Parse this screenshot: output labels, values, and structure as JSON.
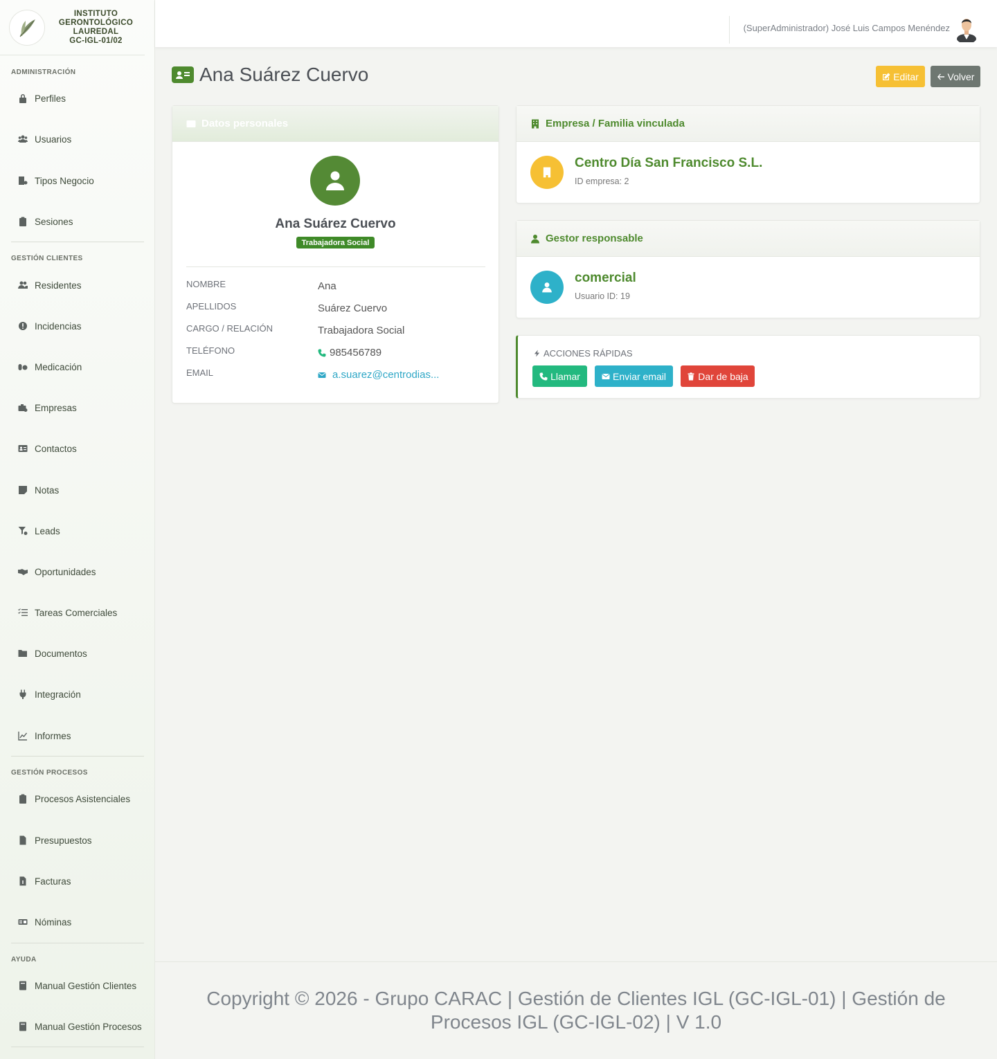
{
  "brand": {
    "lines": [
      "INSTITUTO",
      "GERONTOLÓGICO",
      "LAUREDAL",
      "GC-IGL-01/02"
    ]
  },
  "sidebar": {
    "sections": [
      {
        "label": "ADMINISTRACIÓN",
        "items": [
          {
            "label": "Perfiles",
            "icon": "lock-icon"
          },
          {
            "label": "Usuarios",
            "icon": "users-icon"
          },
          {
            "label": "Tipos Negocio",
            "icon": "building-icon"
          },
          {
            "label": "Sesiones",
            "icon": "clipboard-icon"
          }
        ]
      },
      {
        "label": "GESTIÓN CLIENTES",
        "items": [
          {
            "label": "Residentes",
            "icon": "users-icon"
          },
          {
            "label": "Incidencias",
            "icon": "alert-icon"
          },
          {
            "label": "Medicación",
            "icon": "pills-icon"
          },
          {
            "label": "Empresas",
            "icon": "briefcase-icon"
          },
          {
            "label": "Contactos",
            "icon": "id-card-icon"
          },
          {
            "label": "Notas",
            "icon": "note-icon"
          },
          {
            "label": "Leads",
            "icon": "funnel-icon"
          },
          {
            "label": "Oportunidades",
            "icon": "handshake-icon"
          },
          {
            "label": "Tareas Comerciales",
            "icon": "tasks-icon"
          },
          {
            "label": "Documentos",
            "icon": "folder-icon"
          },
          {
            "label": "Integración",
            "icon": "plug-icon"
          },
          {
            "label": "Informes",
            "icon": "chart-line-icon"
          }
        ]
      },
      {
        "label": "GESTIÓN PROCESOS",
        "items": [
          {
            "label": "Procesos Asistenciales",
            "icon": "clipboard-icon"
          },
          {
            "label": "Presupuestos",
            "icon": "file-icon"
          },
          {
            "label": "Facturas",
            "icon": "invoice-icon"
          },
          {
            "label": "Nóminas",
            "icon": "money-icon"
          }
        ]
      },
      {
        "label": "AYUDA",
        "items": [
          {
            "label": "Manual Gestión Clientes",
            "icon": "book-icon"
          },
          {
            "label": "Manual Gestión Procesos",
            "icon": "book-icon"
          }
        ]
      }
    ]
  },
  "topbar": {
    "user": "(SuperAdministrador) José Luis Campos Menéndez"
  },
  "page": {
    "title": "Ana Suárez Cuervo",
    "edit_label": "Editar",
    "back_label": "Volver"
  },
  "personal": {
    "header": "Datos personales",
    "name": "Ana Suárez Cuervo",
    "role": "Trabajadora Social",
    "fields": [
      {
        "label": "NOMBRE",
        "value": "Ana"
      },
      {
        "label": "APELLIDOS",
        "value": "Suárez Cuervo"
      },
      {
        "label": "CARGO / RELACIÓN",
        "value": "Trabajadora Social"
      },
      {
        "label": "TELÉFONO",
        "value": "985456789"
      },
      {
        "label": "EMAIL",
        "value": "a.suarez@centrodias..."
      }
    ]
  },
  "empresa": {
    "header": "Empresa / Familia vinculada",
    "name": "Centro Día San Francisco S.L.",
    "sub": "ID empresa: 2"
  },
  "gestor": {
    "header": "Gestor responsable",
    "name": "comercial",
    "sub": "Usuario ID: 19"
  },
  "acciones": {
    "title": "ACCIONES RÁPIDAS",
    "call": "Llamar",
    "email": "Enviar email",
    "drop": "Dar de baja"
  },
  "footer": {
    "text": "Copyright © 2026 - Grupo CARAC | Gestión de Clientes IGL (GC-IGL-01) | Gestión de Procesos IGL (GC-IGL-02) | V 1.0"
  },
  "colors": {
    "brand_green": "#4e8a2e",
    "warning": "#f6c034",
    "secondary": "#6e7771",
    "success": "#23b97f",
    "info": "#2eb1c9",
    "danger": "#e0453a"
  }
}
